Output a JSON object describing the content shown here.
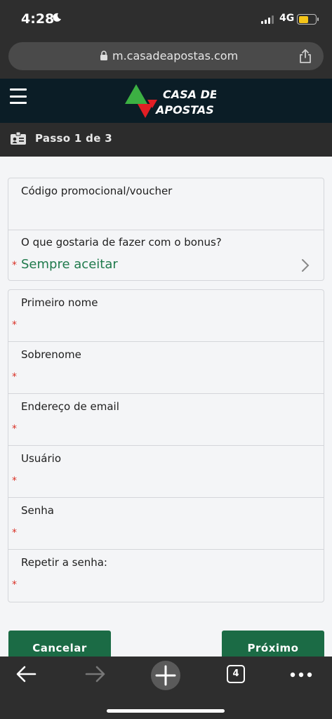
{
  "status_bar": {
    "time": "4:28",
    "network": "4G",
    "battery_level": 0.6
  },
  "browser": {
    "url": "m.casadeapostas.com",
    "tab_count": "4"
  },
  "site": {
    "logo_line1": "CASA DE",
    "logo_line2": "APOSTAS",
    "header_color": "#0b1d26",
    "accent_green": "#1b6b45"
  },
  "step": {
    "label": "Passo 1 de 3"
  },
  "form": {
    "promo": {
      "label": "Código promocional/voucher",
      "bonus_label": "O que gostaria de fazer com o bonus?",
      "bonus_value": "Sempre aceitar",
      "required_mark": "*"
    },
    "fields": [
      {
        "label": "Primeiro nome",
        "required_mark": "*"
      },
      {
        "label": "Sobrenome",
        "required_mark": "*"
      },
      {
        "label": "Endereço de email",
        "required_mark": "*"
      },
      {
        "label": "Usuário",
        "required_mark": "*"
      },
      {
        "label": "Senha",
        "required_mark": "*"
      },
      {
        "label": "Repetir a senha:",
        "required_mark": "*"
      }
    ]
  },
  "buttons": {
    "cancel": "Cancelar",
    "next": "Próximo"
  }
}
